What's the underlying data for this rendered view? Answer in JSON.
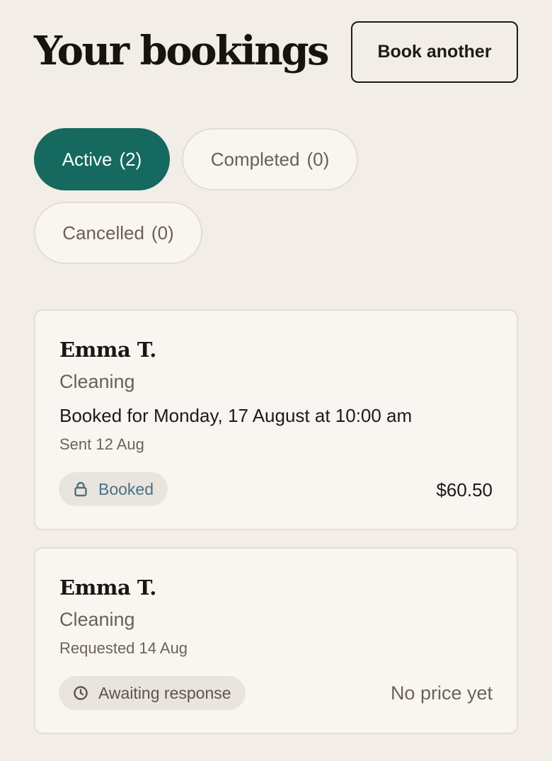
{
  "header": {
    "title": "Your bookings",
    "book_another_label": "Book another"
  },
  "tabs": [
    {
      "label": "Active",
      "count": "(2)",
      "selected": true
    },
    {
      "label": "Completed",
      "count": "(0)",
      "selected": false
    },
    {
      "label": "Cancelled",
      "count": "(0)",
      "selected": false
    }
  ],
  "bookings": [
    {
      "provider": "Emma T.",
      "service": "Cleaning",
      "booked_for": "Booked for Monday, 17 August at 10:00 am",
      "sent": "Sent 12 Aug",
      "status": "Booked",
      "status_icon": "lock-icon",
      "price": "$60.50"
    },
    {
      "provider": "Emma T.",
      "service": "Cleaning",
      "sent": "Requested 14 Aug",
      "status": "Awaiting response",
      "status_icon": "clock-icon",
      "price": "No price yet"
    }
  ],
  "colors": {
    "background": "#f2ede6",
    "accent": "#15695f",
    "card": "#f9f6f1",
    "booked_status": "#4a7184"
  }
}
